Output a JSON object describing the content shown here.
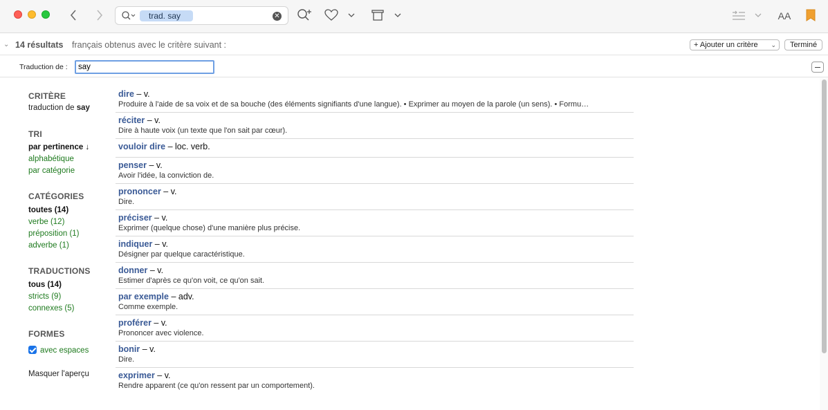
{
  "toolbar": {
    "search_token": "trad. say",
    "clear_icon": "xmark-circle-icon",
    "accent": "#c6dbf6",
    "font_size_label": "AA"
  },
  "results_bar": {
    "count": "14 résultats",
    "description": "français obtenus avec le critère suivant :",
    "add_criterion_label": "+ Ajouter un critère",
    "done_label": "Terminé"
  },
  "criteria_row": {
    "label": "Traduction de :",
    "value": "say"
  },
  "sidebar": {
    "critere": {
      "title": "CRITÈRE",
      "text_prefix": "traduction de",
      "text_value": "say"
    },
    "tri": {
      "title": "TRI",
      "items": [
        "par pertinence ↓",
        "alphabétique",
        "par catégorie"
      ]
    },
    "categories": {
      "title": "CATÉGORIES",
      "items": [
        "toutes (14)",
        "verbe (12)",
        "préposition (1)",
        "adverbe (1)"
      ]
    },
    "traductions": {
      "title": "TRADUCTIONS",
      "items": [
        "tous (14)",
        "stricts (9)",
        "connexes (5)"
      ]
    },
    "formes": {
      "title": "FORMES",
      "checkbox_label": "avec espaces"
    },
    "hide_preview": "Masquer l'aperçu"
  },
  "results": [
    {
      "word": "dire",
      "pos": "– v.",
      "def": "Produire à l'aide de sa voix et de sa bouche (des éléments signifiants d'une langue). • Exprimer au moyen de la parole (un sens). • Formu…"
    },
    {
      "word": "réciter",
      "pos": "– v.",
      "def": "Dire à haute voix (un texte que l'on sait par cœur)."
    },
    {
      "word": "vouloir dire",
      "pos": "– loc. verb.",
      "def": ""
    },
    {
      "word": "penser",
      "pos": "– v.",
      "def": "Avoir l'idée, la conviction de."
    },
    {
      "word": "prononcer",
      "pos": "– v.",
      "def": "Dire."
    },
    {
      "word": "préciser",
      "pos": "– v.",
      "def": "Exprimer (quelque chose) d'une manière plus précise."
    },
    {
      "word": "indiquer",
      "pos": "– v.",
      "def": "Désigner par quelque caractéristique."
    },
    {
      "word": "donner",
      "pos": "– v.",
      "def": "Estimer d'après ce qu'on voit, ce qu'on sait."
    },
    {
      "word": "par exemple",
      "pos": "– adv.",
      "def": "Comme exemple."
    },
    {
      "word": "proférer",
      "pos": "– v.",
      "def": "Prononcer avec violence."
    },
    {
      "word": "bonir",
      "pos": "– v.",
      "def": "Dire."
    },
    {
      "word": "exprimer",
      "pos": "– v.",
      "def": "Rendre apparent (ce qu'on ressent par un comportement)."
    }
  ]
}
